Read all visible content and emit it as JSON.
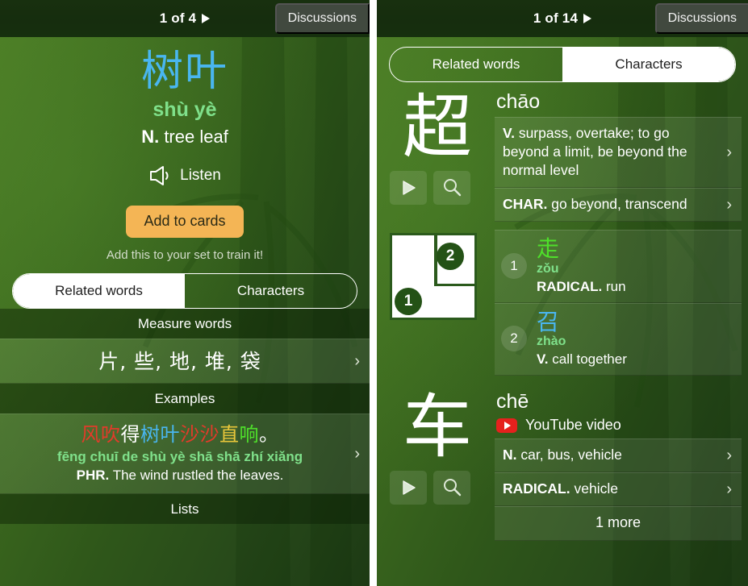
{
  "colors": {
    "hanzi_blue": "#49b6f0",
    "pinyin_green": "#7fe08a",
    "accent_orange": "#f4b555",
    "bright_green": "#4ee02a",
    "red": "#e23b2a",
    "gold": "#e8c63a",
    "youtube_red": "#e5211d",
    "panel_dark": "#16300e"
  },
  "left": {
    "header": {
      "pager": "1 of 4",
      "next_icon": "play-triangle-icon",
      "discussions": "Discussions"
    },
    "headword": {
      "hanzi": "树叶",
      "pinyin": "shù yè",
      "pos": "N.",
      "definition": "tree leaf"
    },
    "listen": {
      "label": "Listen",
      "icon": "speaker-icon"
    },
    "add_to_cards": {
      "label": "Add to cards",
      "hint": "Add this to your set to train it!"
    },
    "tabs": [
      {
        "label": "Related words",
        "active": true
      },
      {
        "label": "Characters",
        "active": false
      }
    ],
    "sections": [
      {
        "header": "Measure words",
        "type": "measure",
        "row": {
          "text": "片, 些, 地, 堆, 袋",
          "chevron": "chevron-right-icon"
        }
      },
      {
        "header": "Examples",
        "type": "example",
        "row": {
          "hanzi_parts": [
            {
              "t": "风吹",
              "c": "#e23b2a"
            },
            {
              "t": "得",
              "c": "#ffffff"
            },
            {
              "t": "树叶",
              "c": "#49b6f0"
            },
            {
              "t": "沙沙",
              "c": "#e23b2a"
            },
            {
              "t": "直",
              "c": "#e8c63a"
            },
            {
              "t": "响",
              "c": "#4ee02a"
            },
            {
              "t": "。",
              "c": "#ffffff"
            }
          ],
          "pinyin": "fēng chuī de shù yè shā shā zhí xiǎng",
          "pos": "PHR.",
          "english": "The wind rustled the leaves.",
          "chevron": "chevron-right-icon"
        }
      },
      {
        "header": "Lists",
        "type": "header-only"
      }
    ]
  },
  "right": {
    "header": {
      "pager": "1 of 14",
      "next_icon": "play-triangle-icon",
      "discussions": "Discussions"
    },
    "tabs": [
      {
        "label": "Related words",
        "active": false
      },
      {
        "label": "Characters",
        "active": true
      }
    ],
    "char_blocks": [
      {
        "glyph": "超",
        "pinyin": "chāo",
        "buttons": [
          "play-icon",
          "search-icon"
        ],
        "definitions": [
          {
            "pos": "V.",
            "text": "surpass, overtake; to go beyond a limit, be beyond the normal level",
            "chevron": "chevron-right-icon"
          },
          {
            "pos": "CHAR.",
            "text": "go beyond, transcend",
            "chevron": "chevron-right-icon"
          }
        ]
      }
    ],
    "decomposition": {
      "diagram_badges": [
        "1",
        "2"
      ],
      "components": [
        {
          "num": "1",
          "hanzi": "走",
          "color": "#4ee02a",
          "pinyin": "zǒu",
          "pos": "RADICAL.",
          "def": "run"
        },
        {
          "num": "2",
          "hanzi": "召",
          "color": "#49b6f0",
          "pinyin": "zhào",
          "pos": "V.",
          "def": "call together"
        }
      ]
    },
    "char_block2": {
      "glyph": "车",
      "pinyin": "chē",
      "buttons": [
        "play-icon",
        "search-icon"
      ],
      "youtube": {
        "label": "YouTube video",
        "icon": "youtube-icon"
      },
      "definitions": [
        {
          "pos": "N.",
          "text": "car, bus, vehicle",
          "chevron": "chevron-right-icon"
        },
        {
          "pos": "RADICAL.",
          "text": "vehicle",
          "chevron": "chevron-right-icon"
        }
      ],
      "more": "1 more"
    }
  }
}
